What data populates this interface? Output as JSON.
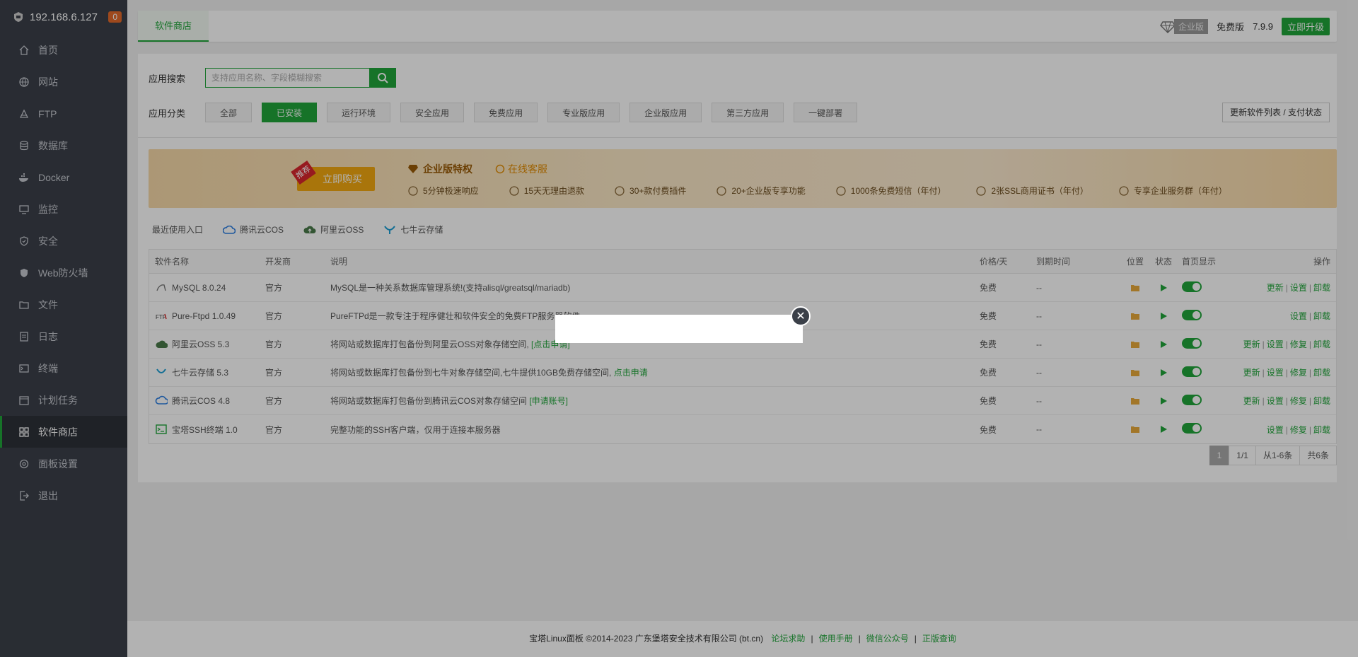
{
  "sidebar": {
    "ip": "192.168.6.127",
    "badge": "0",
    "items": [
      {
        "label": "首页",
        "icon": "home-icon"
      },
      {
        "label": "网站",
        "icon": "globe-icon"
      },
      {
        "label": "FTP",
        "icon": "ftp-icon"
      },
      {
        "label": "数据库",
        "icon": "database-icon"
      },
      {
        "label": "Docker",
        "icon": "docker-icon"
      },
      {
        "label": "监控",
        "icon": "monitor-icon"
      },
      {
        "label": "安全",
        "icon": "shield-icon"
      },
      {
        "label": "Web防火墙",
        "icon": "firewall-icon"
      },
      {
        "label": "文件",
        "icon": "folder-icon"
      },
      {
        "label": "日志",
        "icon": "log-icon"
      },
      {
        "label": "终端",
        "icon": "terminal-icon"
      },
      {
        "label": "计划任务",
        "icon": "calendar-icon"
      },
      {
        "label": "软件商店",
        "icon": "grid-icon"
      },
      {
        "label": "面板设置",
        "icon": "gear-icon"
      },
      {
        "label": "退出",
        "icon": "logout-icon"
      }
    ]
  },
  "topbar": {
    "tab": "软件商店",
    "enterprise": "企业版",
    "free": "免费版",
    "version": "7.9.9",
    "upgrade": "立即升级"
  },
  "search": {
    "label": "应用搜索",
    "placeholder": "支持应用名称、字段模糊搜索"
  },
  "categories": {
    "label": "应用分类",
    "items": [
      "全部",
      "已安装",
      "运行环境",
      "安全应用",
      "免费应用",
      "专业版应用",
      "企业版应用",
      "第三方应用",
      "一键部署"
    ],
    "refresh": "更新软件列表 / 支付状态"
  },
  "banner": {
    "recommend": "推荐",
    "buy": "立即购买",
    "title": "企业版特权",
    "online": "在线客服",
    "features": [
      "5分钟极速响应",
      "15天无理由退款",
      "30+款付费插件",
      "20+企业版专享功能",
      "1000条免费短信（年付）",
      "2张SSL商用证书（年付）",
      "专享企业服务群（年付）"
    ]
  },
  "recent": {
    "label": "最近使用入口",
    "items": [
      "腾讯云COS",
      "阿里云OSS",
      "七牛云存储"
    ]
  },
  "table": {
    "headers": [
      "软件名称",
      "开发商",
      "说明",
      "价格/天",
      "到期时间",
      "位置",
      "状态",
      "首页显示",
      "操作"
    ],
    "rows": [
      {
        "name": "MySQL 8.0.24",
        "dev": "官方",
        "desc": "MySQL是一种关系数据库管理系统!(支持alisql/greatsql/mariadb)",
        "link": "",
        "price": "免费",
        "expire": "--",
        "ops": [
          "更新",
          "设置",
          "卸载"
        ]
      },
      {
        "name": "Pure-Ftpd 1.0.49",
        "dev": "官方",
        "desc": "PureFTPd是一款专注于程序健壮和软件安全的免费FTP服务器软件",
        "link": "",
        "price": "免费",
        "expire": "--",
        "ops": [
          "设置",
          "卸载"
        ]
      },
      {
        "name": "阿里云OSS 5.3",
        "dev": "官方",
        "desc": "将网站或数据库打包备份到阿里云OSS对象存储空间, ",
        "link": "[点击申请]",
        "price": "免费",
        "expire": "--",
        "ops": [
          "更新",
          "设置",
          "修复",
          "卸载"
        ]
      },
      {
        "name": "七牛云存储 5.3",
        "dev": "官方",
        "desc": "将网站或数据库打包备份到七牛对象存储空间,七牛提供10GB免费存储空间, ",
        "link": "点击申请",
        "price": "免费",
        "expire": "--",
        "ops": [
          "更新",
          "设置",
          "修复",
          "卸载"
        ]
      },
      {
        "name": "腾讯云COS 4.8",
        "dev": "官方",
        "desc": "将网站或数据库打包备份到腾讯云COS对象存储空间 ",
        "link": "[申请账号]",
        "price": "免费",
        "expire": "--",
        "ops": [
          "更新",
          "设置",
          "修复",
          "卸载"
        ]
      },
      {
        "name": "宝塔SSH终端 1.0",
        "dev": "官方",
        "desc": "完整功能的SSH客户端，仅用于连接本服务器",
        "link": "",
        "price": "免费",
        "expire": "--",
        "ops": [
          "设置",
          "修复",
          "卸载"
        ]
      }
    ]
  },
  "pager": {
    "current": "1",
    "pages": "1/1",
    "range": "从1-6条",
    "total": "共6条"
  },
  "footer": {
    "copyright": "宝塔Linux面板 ©2014-2023 广东堡塔安全技术有限公司 (bt.cn)",
    "links": [
      "论坛求助",
      "使用手册",
      "微信公众号",
      "正版查询"
    ]
  },
  "colors": {
    "accent": "#20a53a",
    "sidebar": "#3b4049"
  }
}
